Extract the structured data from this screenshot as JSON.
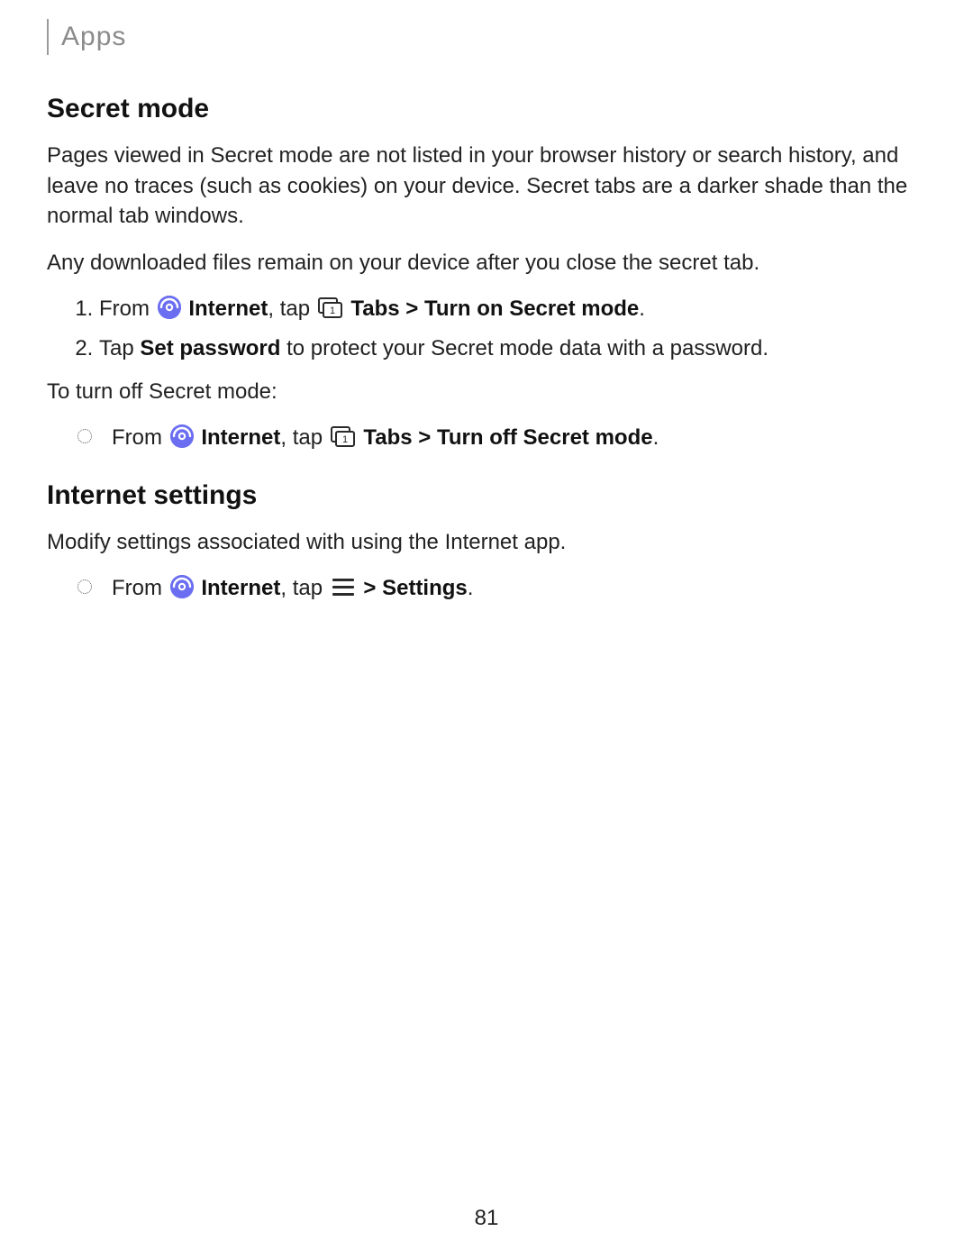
{
  "header": {
    "section": "Apps"
  },
  "secret_mode": {
    "heading": "Secret mode",
    "para1": "Pages viewed in Secret mode are not listed in your browser history or search history, and leave no traces (such as cookies) on your device. Secret tabs are a darker shade than the normal tab windows.",
    "para2": "Any downloaded files remain on your device after you close the secret tab.",
    "step1": {
      "from": "From ",
      "internet": "Internet",
      "tap": ", tap ",
      "tabs": "Tabs",
      "sep": " > ",
      "action": "Turn on Secret mode",
      "end": "."
    },
    "step2": {
      "pre": "Tap ",
      "bold": "Set password",
      "post": " to protect your Secret mode data with a password."
    },
    "turn_off_intro": "To turn off Secret mode:",
    "turn_off": {
      "from": "From ",
      "internet": "Internet",
      "tap": ", tap ",
      "tabs": "Tabs",
      "sep": " > ",
      "action": "Turn off Secret mode",
      "end": "."
    }
  },
  "internet_settings": {
    "heading": "Internet settings",
    "para": "Modify settings associated with using the Internet app.",
    "step": {
      "from": "From ",
      "internet": "Internet",
      "tap": ", tap ",
      "sep": " > ",
      "action": "Settings",
      "end": "."
    }
  },
  "icons": {
    "tabs_number": "1"
  },
  "page_number": "81"
}
